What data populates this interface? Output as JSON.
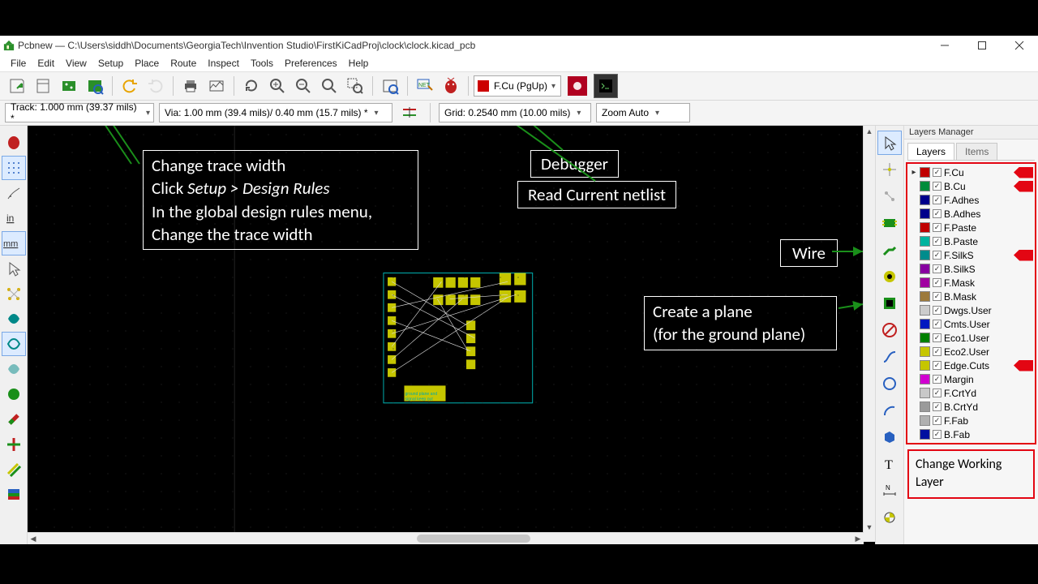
{
  "window": {
    "title": "Pcbnew — C:\\Users\\siddh\\Documents\\GeorgiaTech\\Invention Studio\\FirstKiCadProj\\clock\\clock.kicad_pcb"
  },
  "menu": [
    "File",
    "Edit",
    "View",
    "Setup",
    "Place",
    "Route",
    "Inspect",
    "Tools",
    "Preferences",
    "Help"
  ],
  "toolbar1": {
    "layer_selected": "F.Cu (PgUp)"
  },
  "toolbar2": {
    "track": "Track: 1.000 mm (39.37 mils) *",
    "via": "Via: 1.00 mm (39.4 mils)/ 0.40 mm (15.7 mils) *",
    "grid": "Grid: 0.2540 mm (10.00 mils)",
    "zoom": "Zoom Auto"
  },
  "layers": {
    "title": "Layers Manager",
    "tabs": {
      "layers": "Layers",
      "items": "Items"
    },
    "list": [
      {
        "ptr": "▸",
        "color": "#c00000",
        "name": "F.Cu",
        "arrow": true
      },
      {
        "ptr": "",
        "color": "#008c3a",
        "name": "B.Cu",
        "arrow": true
      },
      {
        "ptr": "",
        "color": "#00008b",
        "name": "F.Adhes"
      },
      {
        "ptr": "",
        "color": "#00008b",
        "name": "B.Adhes"
      },
      {
        "ptr": "",
        "color": "#c00000",
        "name": "F.Paste"
      },
      {
        "ptr": "",
        "color": "#00b39e",
        "name": "B.Paste"
      },
      {
        "ptr": "",
        "color": "#008c8c",
        "name": "F.SilkS",
        "arrow": true
      },
      {
        "ptr": "",
        "color": "#8800a0",
        "name": "B.SilkS"
      },
      {
        "ptr": "",
        "color": "#a000a0",
        "name": "F.Mask"
      },
      {
        "ptr": "",
        "color": "#9c7a3c",
        "name": "B.Mask"
      },
      {
        "ptr": "",
        "color": "#cccccc",
        "name": "Dwgs.User"
      },
      {
        "ptr": "",
        "color": "#0018c0",
        "name": "Cmts.User"
      },
      {
        "ptr": "",
        "color": "#008000",
        "name": "Eco1.User"
      },
      {
        "ptr": "",
        "color": "#c6c600",
        "name": "Eco2.User"
      },
      {
        "ptr": "",
        "color": "#c6c600",
        "name": "Edge.Cuts",
        "arrow": true
      },
      {
        "ptr": "",
        "color": "#d100d1",
        "name": "Margin"
      },
      {
        "ptr": "",
        "color": "#c8c8c8",
        "name": "F.CrtYd"
      },
      {
        "ptr": "",
        "color": "#9a9a9a",
        "name": "B.CrtYd"
      },
      {
        "ptr": "",
        "color": "#b0b0b0",
        "name": "F.Fab"
      },
      {
        "ptr": "",
        "color": "#0010a0",
        "name": "B.Fab"
      }
    ],
    "note": "Change Working Layer"
  },
  "annotations": {
    "trace_title": "Change trace width",
    "trace_l2a": "Click ",
    "trace_l2b": "Setup > Design Rules",
    "trace_l3": "In the global design rules menu,",
    "trace_l4": "Change the trace width",
    "debugger": "Debugger",
    "netlist": "Read Current netlist",
    "wire": "Wire",
    "plane_l1": "Create a plane",
    "plane_l2": "(for the ground plane)"
  }
}
